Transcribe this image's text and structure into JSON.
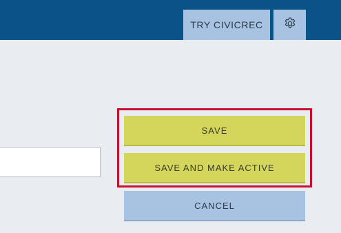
{
  "header": {
    "try_label": "TRY CIVICREC",
    "settings_icon": "gear-icon"
  },
  "form": {
    "input_value": ""
  },
  "actions": {
    "save_label": "SAVE",
    "save_active_label": "SAVE AND MAKE ACTIVE",
    "cancel_label": "CANCEL"
  },
  "colors": {
    "header_bg": "#0b5288",
    "primary_button": "#d3d65a",
    "secondary_button": "#a8c3e2",
    "highlight_border": "#c8102e",
    "page_bg": "#e9ecf1"
  }
}
